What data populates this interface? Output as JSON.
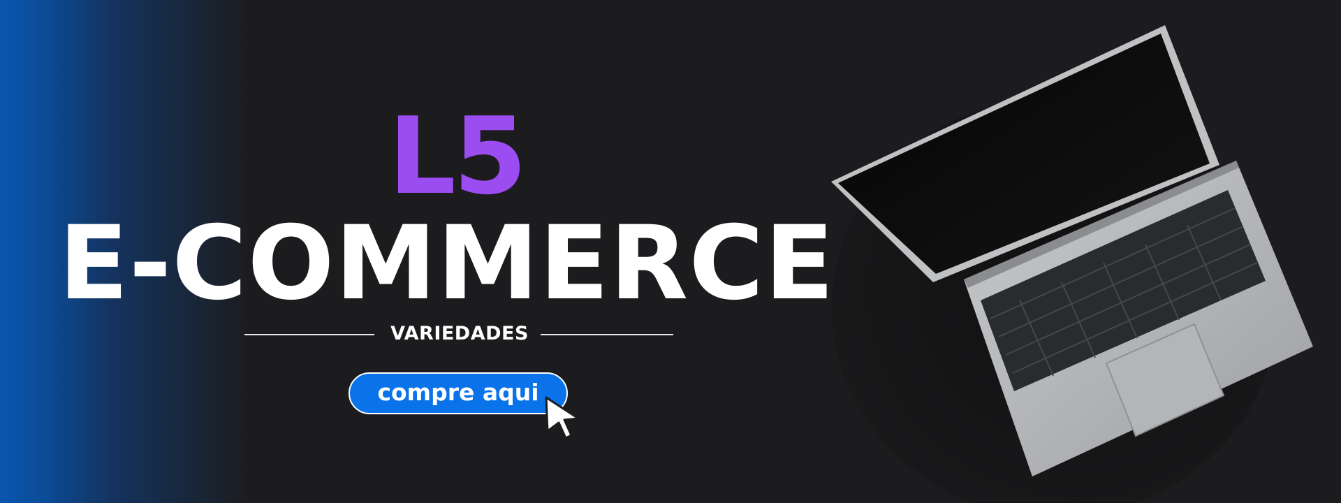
{
  "banner": {
    "brand": "L5",
    "headline": "E-COMMERCE",
    "subtitle": "VARIEDADES",
    "cta_label": "compre aqui"
  },
  "colors": {
    "brand": "#9b4df2",
    "headline": "#ffffff",
    "cta_background": "#0a73ea",
    "background": "#1c1c1e",
    "glow": "#0a57b0"
  },
  "icons": {
    "cursor": "pointer-cursor-icon",
    "device": "laptop-image"
  }
}
